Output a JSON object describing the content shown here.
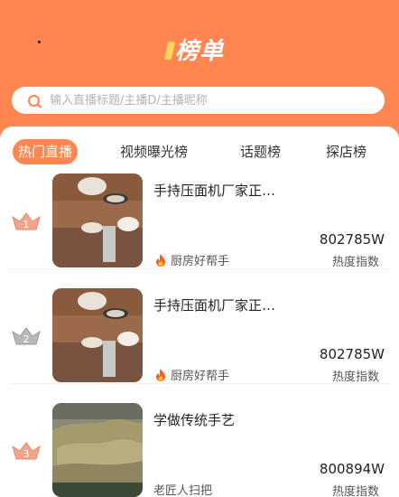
{
  "header": {
    "title": "榜单"
  },
  "search": {
    "placeholder": "输入直播标题/主播D/主播昵称"
  },
  "tabs": [
    {
      "label": "热门直播",
      "active": true
    },
    {
      "label": "视频曝光榜",
      "active": false
    },
    {
      "label": "话题榜",
      "active": false
    },
    {
      "label": "探店榜",
      "active": false
    }
  ],
  "items": [
    {
      "rank": "1",
      "title": "手持压面机厂家正…",
      "author": "厨房好帮手",
      "hot": true,
      "heat": "802785W",
      "heat_label": "热度指数"
    },
    {
      "rank": "2",
      "title": "手持压面机厂家正…",
      "author": "厨房好帮手",
      "hot": true,
      "heat": "802785W",
      "heat_label": "热度指数"
    },
    {
      "rank": "3",
      "title": "学做传统手艺",
      "author": "老匠人扫把",
      "hot": false,
      "heat": "800894W",
      "heat_label": "热度指数"
    }
  ],
  "colors": {
    "accent": "#ff8650",
    "rank1": "#f2a58a",
    "rank2": "#b8b8b8",
    "rank3": "#f2a58a"
  }
}
